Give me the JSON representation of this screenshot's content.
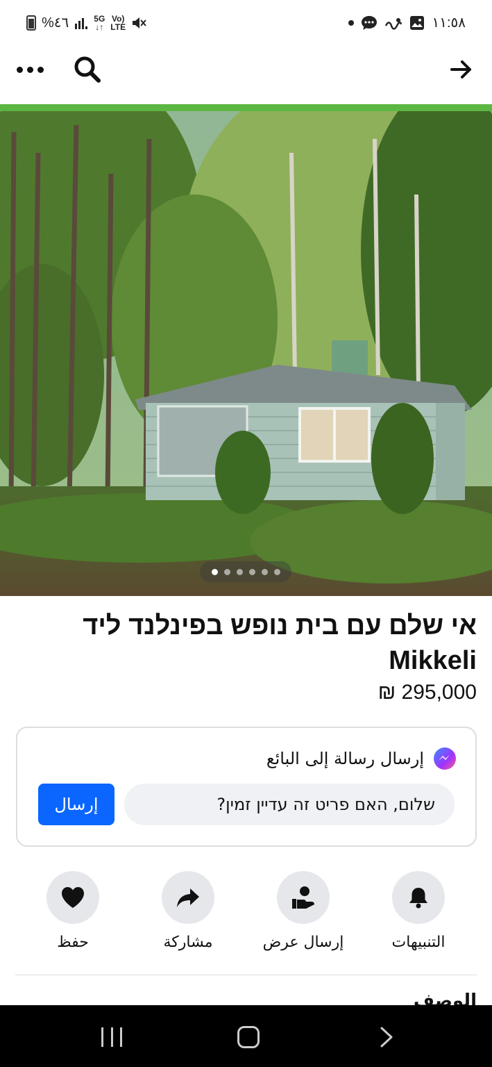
{
  "status_bar": {
    "battery_text": "%٤٦",
    "signal_5g": "5G",
    "signal_lte_top": "Vo)",
    "signal_lte_bottom": "LTE",
    "time": "١١:٥٨"
  },
  "top_nav": {
    "more_icon": "more-dots-icon",
    "search_icon": "search-icon",
    "back_icon": "arrow-right-icon"
  },
  "listing": {
    "title": "אי שלם עם בית נופש בפינלנד ליד Mikkeli",
    "price": "295,000 ₪",
    "photo_count": 6,
    "active_photo": 1
  },
  "message_card": {
    "heading": "إرسال رسالة إلى البائع",
    "input_value": "שלום, האם פריט זה עדיין זמין?",
    "send_label": "إرسال"
  },
  "actions": [
    {
      "label": "التنبيهات",
      "icon": "bell-icon"
    },
    {
      "label": "إرسال عرض",
      "icon": "offer-hand-icon"
    },
    {
      "label": "مشاركة",
      "icon": "share-arrow-icon"
    },
    {
      "label": "حفظ",
      "icon": "heart-icon"
    }
  ],
  "section_heading_partial": "الوصف",
  "colors": {
    "accent_green": "#5cb742",
    "primary_blue": "#0a66ff",
    "circle_gray": "#e5e7eb"
  }
}
